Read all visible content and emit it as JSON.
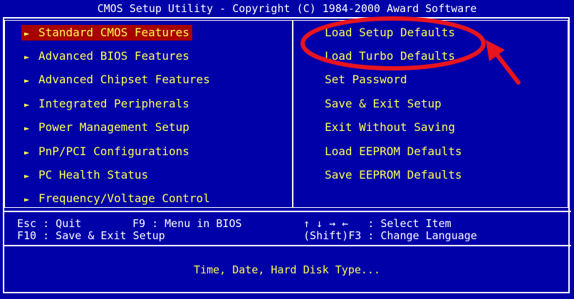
{
  "title": "CMOS Setup Utility - Copyright (C) 1984-2000 Award Software",
  "left_menu": [
    {
      "label": "Standard CMOS Features"
    },
    {
      "label": "Advanced BIOS Features"
    },
    {
      "label": "Advanced Chipset Features"
    },
    {
      "label": "Integrated Peripherals"
    },
    {
      "label": "Power Management Setup"
    },
    {
      "label": "PnP/PCI Configurations"
    },
    {
      "label": "PC Health Status"
    },
    {
      "label": "Frequency/Voltage Control"
    }
  ],
  "right_menu": [
    {
      "label": "Load Setup Defaults"
    },
    {
      "label": "Load Turbo Defaults"
    },
    {
      "label": "Set Password"
    },
    {
      "label": "Save & Exit Setup"
    },
    {
      "label": "Exit Without Saving"
    },
    {
      "label": "Load EEPROM Defaults"
    },
    {
      "label": "Save EEPROM Defaults"
    }
  ],
  "arrow_glyph": "►",
  "footer": {
    "esc": "Esc : Quit",
    "f9": "F9 : Menu in BIOS",
    "f10": "F10 : Save & Exit Setup",
    "select": "↑ ↓ → ←   : Select Item",
    "lang": "(Shift)F3 : Change Language"
  },
  "description": "Time, Date, Hard Disk Type...",
  "colors": {
    "background": "#0000A8",
    "menu_text": "#FFFF54",
    "selected_bg": "#A80000",
    "annotation": "#E8141E"
  }
}
